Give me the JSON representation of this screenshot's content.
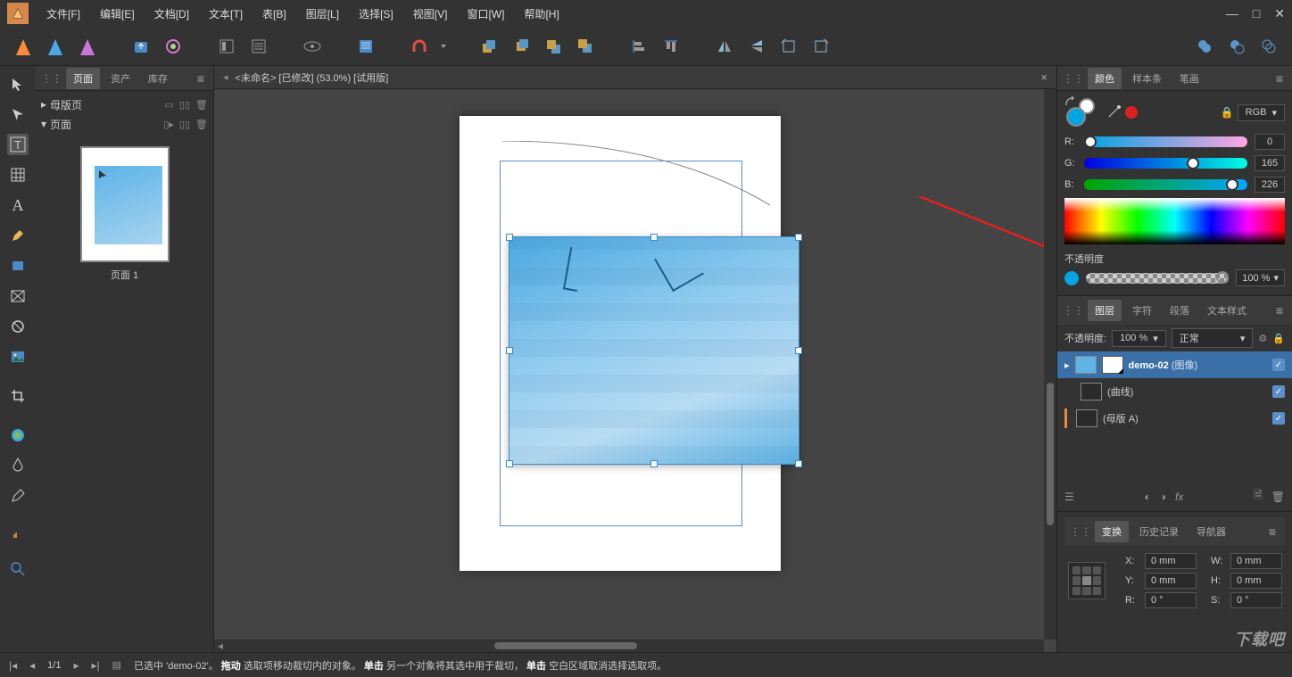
{
  "menu": [
    "文件[F]",
    "编辑[E]",
    "文档[D]",
    "文本[T]",
    "表[B]",
    "图层[L]",
    "选择[S]",
    "视图[V]",
    "窗口[W]",
    "帮助[H]"
  ],
  "document": {
    "tab_title": "<未命名> [已修改] (53.0%) [试用版]"
  },
  "left_panel": {
    "tabs": [
      "页面",
      "资产",
      "库存"
    ],
    "master_pages": "母版页",
    "pages": "页面",
    "page1_label": "页面 1"
  },
  "color": {
    "tabs": [
      "颜色",
      "样本条",
      "笔画"
    ],
    "mode": "RGB",
    "r_label": "R:",
    "r_val": "0",
    "g_label": "G:",
    "g_val": "165",
    "b_label": "B:",
    "b_val": "226",
    "opacity_label": "不透明度",
    "opacity_val": "100 %"
  },
  "layers": {
    "tabs": [
      "图层",
      "字符",
      "段落",
      "文本样式"
    ],
    "opacity_label": "不透明度:",
    "opacity_val": "100 %",
    "blend": "正常",
    "item1_name": "demo-02",
    "item1_type": "(图像)",
    "item2_name": "(曲线)",
    "item3_name": "(母版 A)"
  },
  "transform": {
    "tabs": [
      "变换",
      "历史记录",
      "导航器"
    ],
    "x_label": "X:",
    "x_val": "0 mm",
    "y_label": "Y:",
    "y_val": "0 mm",
    "w_label": "W:",
    "w_val": "0 mm",
    "h_label": "H:",
    "h_val": "0 mm",
    "r_label": "R:",
    "r_val": "0 °",
    "s_label": "S:",
    "s_val": "0 °"
  },
  "status": {
    "page_count": "1/1",
    "selected_prefix": "已选中 '",
    "selected_name": "demo-02",
    "selected_suffix": "'。",
    "drag_b": "拖动",
    "drag_t": " 选取项移动裁切内的对象。",
    "click1_b": "单击",
    "click1_t": " 另一个对象将其选中用于裁切，",
    "click2_b": "单击",
    "click2_t": " 空白区域取消选择选取项。"
  },
  "watermark": "下载吧"
}
